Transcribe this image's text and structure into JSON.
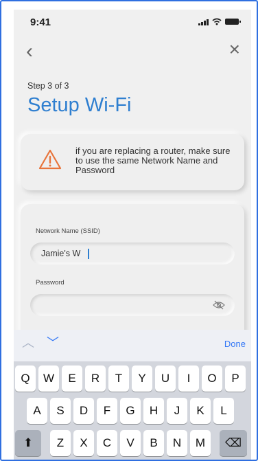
{
  "status_bar": {
    "time": "9:41"
  },
  "nav": {
    "back_glyph": "‹",
    "close_glyph": "×"
  },
  "header": {
    "step": "Step 3 of 3",
    "title": "Setup Wi-Fi"
  },
  "warning": {
    "icon": "warning-triangle-icon",
    "text": "if you are replacing a router, make sure to use the same Network Name and Password"
  },
  "form": {
    "network_name": {
      "label": "Network Name (SSID)",
      "value": "Jamie's W"
    },
    "password": {
      "label": "Password",
      "value": ""
    }
  },
  "accessory": {
    "up_glyph": "︿",
    "down_glyph": "﹀",
    "done_label": "Done"
  },
  "keyboard": {
    "row1": [
      "Q",
      "W",
      "E",
      "R",
      "T",
      "Y",
      "U",
      "I",
      "O",
      "P"
    ],
    "row2": [
      "A",
      "S",
      "D",
      "F",
      "G",
      "H",
      "J",
      "K",
      "L"
    ],
    "row3": [
      "Z",
      "X",
      "C",
      "V",
      "B",
      "N",
      "M"
    ],
    "shift_glyph": "⬆",
    "delete_glyph": "⌫"
  },
  "colors": {
    "accent": "#2f7fd0",
    "ios_blue": "#3478f6",
    "warning": "#e8743b",
    "frame": "#2f6fe0"
  }
}
